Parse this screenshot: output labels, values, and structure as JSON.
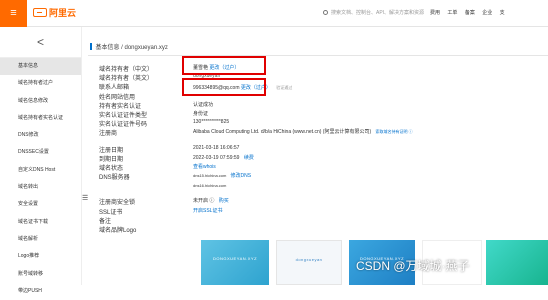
{
  "topbar": {
    "brand": "阿里云",
    "search_placeholder": "搜索文档、控制台、API、解决方案和资源",
    "links": [
      "费用",
      "工单",
      "备案",
      "企业",
      "支"
    ]
  },
  "sidebar": {
    "collapse_glyph": "<",
    "items": [
      "基本信息",
      "域名持有者过户",
      "域名信息修改",
      "域名持有者实名认证",
      "DNS修改",
      "DNSSEC设置",
      "自定义DNS Host",
      "域名转出",
      "安全设置",
      "域名证书下载",
      "域名解析",
      "Logo推荐",
      "账号域转移",
      "带边PUSH"
    ],
    "handle_glyph": "☰"
  },
  "breadcrumb": "基本信息 / dongxueyan.xyz",
  "fields": {
    "holder_cn_label": "域名持有者（中文）",
    "holder_en_label": "域名持有者（英文）",
    "email_label": "联系人邮箱",
    "guardian_label": "姓名网站信用",
    "holder_verify_label": "持有者实名认证",
    "cert_type_label": "实名认证证件类型",
    "cert_no_label": "实名认证证件号码",
    "registrar_label": "注册商",
    "reg_date_label": "注册日期",
    "exp_date_label": "到期日期",
    "status_label": "域名状态",
    "dns_label": "DNS服务器",
    "security_label": "注册商安全锁",
    "ssl_label": "SSL证书",
    "remark_label": "备注",
    "logo_label": "域名品牌Logo"
  },
  "values": {
    "holder_cn": "董雪艳",
    "holder_cn_action": "更改（过户）",
    "holder_en": "dongxueyan",
    "email": "996334895@qq.com",
    "email_action": "更改（过户）",
    "email_status": "验证通过",
    "holder_verify": "认证成功",
    "cert_type": "身份证",
    "cert_no": "130**********825",
    "registrar": "Alibaba Cloud Computing Ltd. d/b/a HiChina (www.net.cn) (阿里云计算有限公司)",
    "registrar_action": "索取域名持有证明 ⓘ",
    "reg_date": "2021-03-18 16:06:57",
    "exp_date": "2022-03-19 07:59:59",
    "exp_action": "续费",
    "status": "查看whois",
    "dns1": "dns15.hichina.com",
    "dns_action": "修改DNS",
    "dns2": "dns16.hichina.com",
    "security": "未开启 ⓘ",
    "security_action": "购买",
    "ssl": "开启SSL证书"
  },
  "thumbs": [
    "DONGXUEYAN.XYZ",
    "dongxueyan",
    "DONGXUEYAN.XYZ",
    "",
    ""
  ],
  "watermark": "CSDN @万域城·燕子"
}
